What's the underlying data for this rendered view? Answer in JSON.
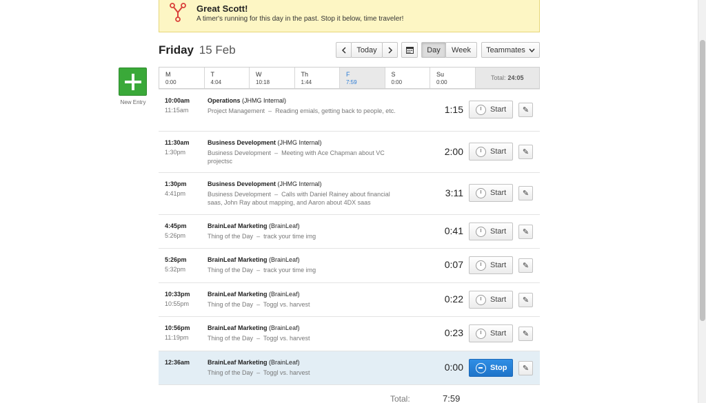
{
  "banner": {
    "title": "Great Scott!",
    "message": "A timer's running for this day in the past. Stop it below, time traveler!",
    "icon": "flux-capacitor-icon",
    "accent": "#d9403a"
  },
  "header": {
    "day_of_week": "Friday",
    "date": "15 Feb",
    "today_label": "Today",
    "prev_icon": "chevron-left",
    "next_icon": "chevron-right",
    "calendar_icon": "calendar",
    "view_day": "Day",
    "view_week": "Week",
    "teammates_label": "Teammates"
  },
  "new_entry": {
    "label": "New Entry",
    "color": "#3aa939"
  },
  "week": {
    "days": [
      {
        "name": "M",
        "value": "0:00"
      },
      {
        "name": "T",
        "value": "4:04"
      },
      {
        "name": "W",
        "value": "10:18"
      },
      {
        "name": "Th",
        "value": "1:44"
      },
      {
        "name": "F",
        "value": "7:59"
      },
      {
        "name": "S",
        "value": "0:00"
      },
      {
        "name": "Su",
        "value": "0:00"
      }
    ],
    "selected_index": 4,
    "total_label": "Total:",
    "total_value": "24:05"
  },
  "entries": [
    {
      "start": "10:00am",
      "end": "11:15am",
      "project": "Operations",
      "client": "(JHMG Internal)",
      "task": "Project Management",
      "sep": "–",
      "notes": "Reading emials, getting back to people, etc.",
      "duration": "1:15",
      "button": "Start"
    },
    {
      "start": "11:30am",
      "end": "1:30pm",
      "project": "Business Development",
      "client": "(JHMG Internal)",
      "task": "Business Development",
      "sep": "–",
      "notes": "Meeting with Ace Chapman about VC projectsc",
      "duration": "2:00",
      "button": "Start"
    },
    {
      "start": "1:30pm",
      "end": "4:41pm",
      "project": "Business Development",
      "client": "(JHMG Internal)",
      "task": "Business Development",
      "sep": "–",
      "notes": "Calls with Daniel Rainey about financial saas, John Ray about mapping, and Aaron about 4DX saas",
      "duration": "3:11",
      "button": "Start"
    },
    {
      "start": "4:45pm",
      "end": "5:26pm",
      "project": "BrainLeaf Marketing",
      "client": "(BrainLeaf)",
      "task": "Thing of the Day",
      "sep": "–",
      "notes": "track your time img",
      "duration": "0:41",
      "button": "Start"
    },
    {
      "start": "5:26pm",
      "end": "5:32pm",
      "project": "BrainLeaf Marketing",
      "client": "(BrainLeaf)",
      "task": "Thing of the Day",
      "sep": "–",
      "notes": "track your time img",
      "duration": "0:07",
      "button": "Start"
    },
    {
      "start": "10:33pm",
      "end": "10:55pm",
      "project": "BrainLeaf Marketing",
      "client": "(BrainLeaf)",
      "task": "Thing of the Day",
      "sep": "–",
      "notes": "Toggl vs. harvest",
      "duration": "0:22",
      "button": "Start"
    },
    {
      "start": "10:56pm",
      "end": "11:19pm",
      "project": "BrainLeaf Marketing",
      "client": "(BrainLeaf)",
      "task": "Thing of the Day",
      "sep": "–",
      "notes": "Toggl vs. harvest",
      "duration": "0:23",
      "button": "Start"
    },
    {
      "start": "12:36am",
      "end": "",
      "project": "BrainLeaf Marketing",
      "client": "(BrainLeaf)",
      "task": "Thing of the Day",
      "sep": "–",
      "notes": "Toggl vs. harvest",
      "duration": "0:00",
      "button": "Stop",
      "running": true
    }
  ],
  "footer": {
    "total_label": "Total:",
    "total_value": "7:59"
  },
  "colors": {
    "stop_button": "#2580d8",
    "selected_day": "#2b7bd5",
    "running_row": "#e3eef5"
  }
}
